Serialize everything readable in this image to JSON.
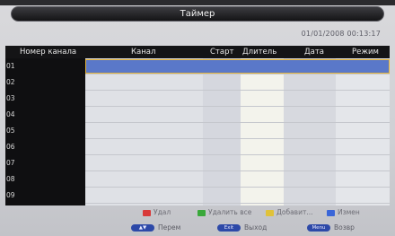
{
  "title": "Таймер",
  "datetime": "01/01/2008 00:13:17",
  "columns": [
    {
      "label": "Номер канала"
    },
    {
      "label": "Канал"
    },
    {
      "label": "Старт"
    },
    {
      "label": "Длитель"
    },
    {
      "label": "Дата"
    },
    {
      "label": "Режим"
    }
  ],
  "rows": [
    "01",
    "02",
    "03",
    "04",
    "05",
    "06",
    "07",
    "08",
    "09"
  ],
  "selected_row": 0,
  "colors": {
    "red": "#d83a3a",
    "green": "#39a83a",
    "yellow": "#e0c23a",
    "blue": "#3a66d8",
    "selection": "#5a78c9"
  },
  "legend": {
    "delete": "Удал",
    "delete_all": "Удалить все",
    "add": "Добавит...",
    "edit": "Измен"
  },
  "nav": {
    "move_key": "▲▼",
    "move_label": "Перем",
    "exit_key": "Exit",
    "exit_label": "Выход",
    "menu_key": "Menu",
    "menu_label": "Возвр"
  }
}
